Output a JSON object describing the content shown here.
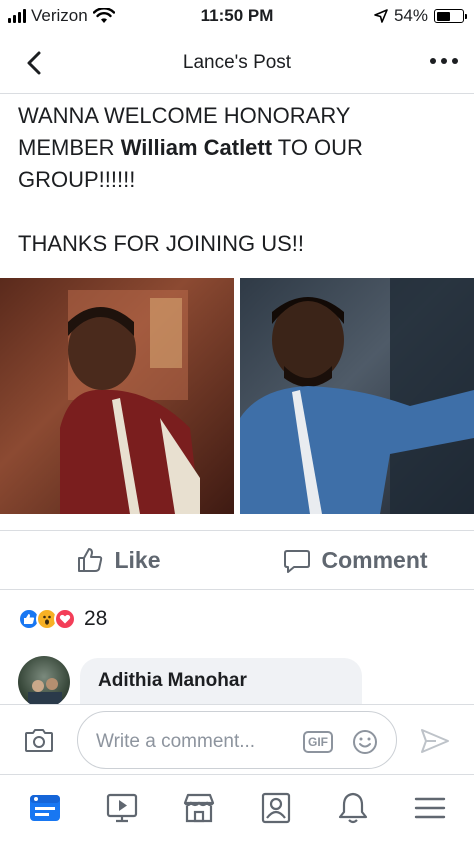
{
  "status_bar": {
    "carrier": "Verizon",
    "time": "11:50 PM",
    "battery": "54%",
    "battery_level": 0.54,
    "icons": [
      "signal-icon",
      "wifi-icon",
      "location-arrow-icon",
      "battery-icon"
    ]
  },
  "nav": {
    "title": "Lance's Post",
    "back_icon": "chevron-left-icon",
    "more_icon": "more-dots-icon"
  },
  "post": {
    "line1a": "WANNA WELCOME HONORARY",
    "line2a": "MEMBER ",
    "line2_bold": "William Catlett",
    "line2b": " TO OUR",
    "line3": "GROUP!!!!!!",
    "line4": "THANKS FOR JOINING US!!"
  },
  "actions": {
    "like_label": "Like",
    "comment_label": "Comment"
  },
  "reactions": {
    "count": "28",
    "types": [
      "like-reaction-icon",
      "wow-reaction-icon",
      "love-reaction-icon"
    ]
  },
  "comment": {
    "author": "Adithia Manohar"
  },
  "composer": {
    "placeholder": "Write a comment...",
    "gif_label": "GIF"
  },
  "tab_bar": {
    "items": [
      "news-feed-tab",
      "watch-tab",
      "marketplace-tab",
      "profile-tab",
      "notifications-tab",
      "menu-tab"
    ]
  },
  "colors": {
    "accent": "#1877f2",
    "text": "#1c1e21",
    "secondary": "#606770",
    "divider": "#dadde1"
  }
}
